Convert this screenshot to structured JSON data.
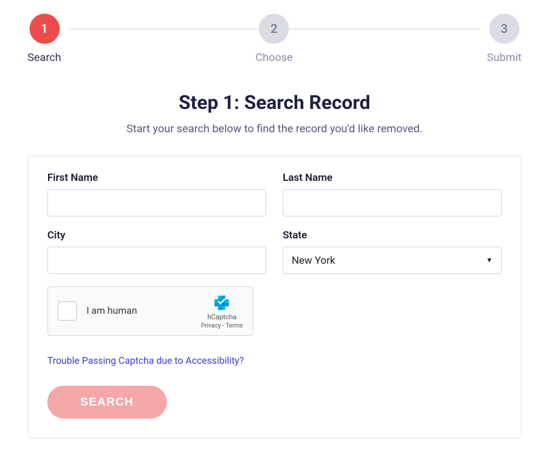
{
  "stepper": {
    "steps": [
      {
        "num": "1",
        "label": "Search",
        "active": true
      },
      {
        "num": "2",
        "label": "Choose",
        "active": false
      },
      {
        "num": "3",
        "label": "Submit",
        "active": false
      }
    ]
  },
  "heading": {
    "title": "Step 1: Search Record",
    "subtitle": "Start your search below to find the record you'd like removed."
  },
  "form": {
    "first_name": {
      "label": "First Name",
      "value": ""
    },
    "last_name": {
      "label": "Last Name",
      "value": ""
    },
    "city": {
      "label": "City",
      "value": ""
    },
    "state": {
      "label": "State",
      "selected": "New York"
    }
  },
  "captcha": {
    "label": "I am human",
    "brand": "hCaptcha",
    "links": "Privacy - Terms"
  },
  "accessibility_link": "Trouble Passing Captcha due to Accessibility?",
  "search_button": "SEARCH"
}
